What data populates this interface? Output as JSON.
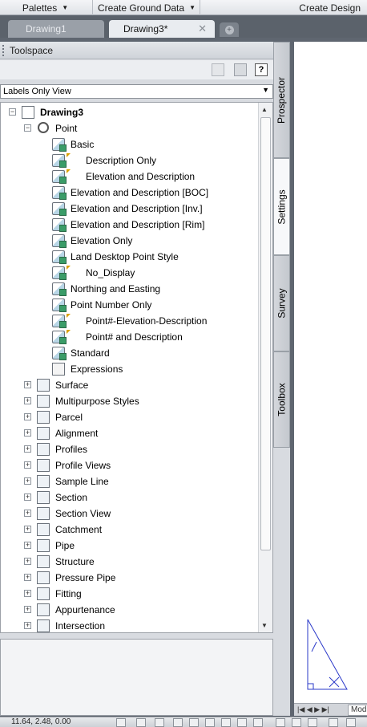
{
  "menubar": {
    "palettes": "Palettes",
    "create_ground_data": "Create Ground Data",
    "create_design": "Create Design"
  },
  "tabs": {
    "drawing1": "Drawing1",
    "drawing3": "Drawing3*",
    "close_symbol": "✕"
  },
  "toolspace": {
    "title": "Toolspace",
    "help": "?",
    "view_select": "Labels Only View"
  },
  "tree": {
    "root": "Drawing3",
    "point": "Point",
    "point_styles": [
      {
        "label": "Basic",
        "flag": false
      },
      {
        "label": "Description Only",
        "flag": true
      },
      {
        "label": "Elevation and Description",
        "flag": true
      },
      {
        "label": "Elevation and Description [BOC]",
        "flag": false
      },
      {
        "label": "Elevation and Description [Inv.]",
        "flag": false
      },
      {
        "label": "Elevation and Description [Rim]",
        "flag": false
      },
      {
        "label": "Elevation Only",
        "flag": false
      },
      {
        "label": "Land Desktop Point Style",
        "flag": false
      },
      {
        "label": "No_Display",
        "flag": true
      },
      {
        "label": "Northing and Easting",
        "flag": false
      },
      {
        "label": "Point Number Only",
        "flag": false
      },
      {
        "label": "Point#-Elevation-Description",
        "flag": true
      },
      {
        "label": "Point# and Description",
        "flag": true
      },
      {
        "label": "Standard",
        "flag": false
      }
    ],
    "expressions": "Expressions",
    "collections": [
      "Surface",
      "Multipurpose Styles",
      "Parcel",
      "Alignment",
      "Profiles",
      "Profile Views",
      "Sample Line",
      "Section",
      "Section View",
      "Catchment",
      "Pipe",
      "Structure",
      "Pressure Pipe",
      "Fitting",
      "Appurtenance",
      "Intersection"
    ]
  },
  "side_tabs": {
    "prospector": "Prospector",
    "settings": "Settings",
    "survey": "Survey",
    "toolbox": "Toolbox"
  },
  "layout": {
    "model_tab": "Mod"
  },
  "status": {
    "coords": "11.64, 2.48, 0.00"
  }
}
